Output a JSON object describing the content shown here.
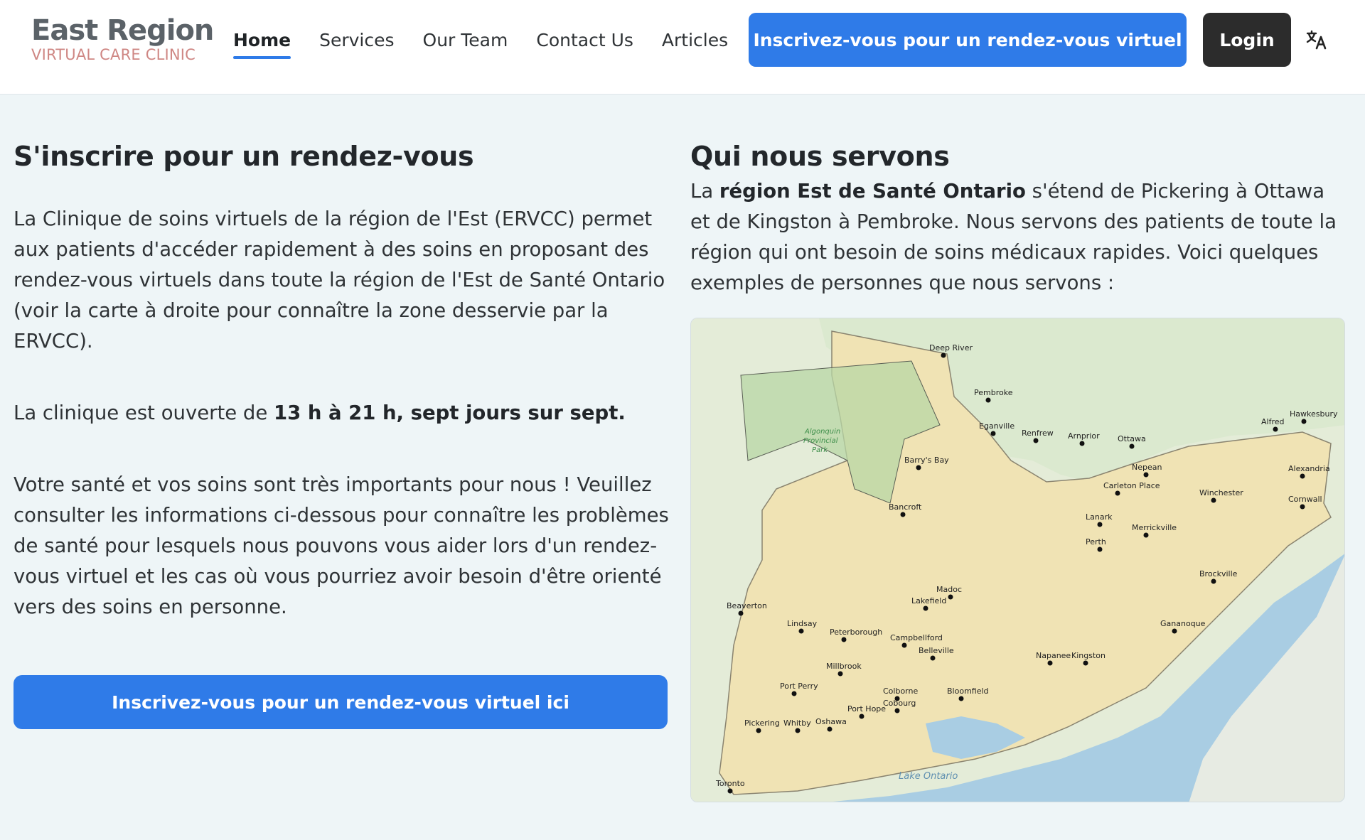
{
  "header": {
    "logo_line1": "East Region",
    "logo_line2": "VIRTUAL CARE CLINIC",
    "nav": [
      {
        "label": "Home",
        "active": true
      },
      {
        "label": "Services"
      },
      {
        "label": "Our Team"
      },
      {
        "label": "Contact Us"
      },
      {
        "label": "Articles"
      }
    ],
    "signup_label": "Inscrivez-vous pour un rendez-vous virtuel",
    "login_label": "Login",
    "translate_icon": "translate-icon"
  },
  "left": {
    "title": "S'inscrire pour un rendez-vous",
    "p1": "La Clinique de soins virtuels de la région de l'Est (ERVCC) permet aux patients d'accéder rapidement à des soins en proposant des rendez-vous virtuels dans toute la région de l'Est de Santé Ontario (voir la carte à droite pour connaître la zone desservie par la ERVCC).",
    "p2_pre": "La clinique est ouverte de ",
    "p2_bold": "13 h à 21 h, sept jours sur sept.",
    "p3": "Votre santé et vos soins sont très importants pour nous ! Veuillez consulter les informations ci-dessous pour connaître les problèmes de santé pour lesquels nous pouvons vous aider lors d'un rendez-vous virtuel et les cas où vous pourriez avoir besoin d'être orienté vers des soins en personne.",
    "button_label": "Inscrivez-vous pour un rendez-vous virtuel ici"
  },
  "right": {
    "title": "Qui nous servons",
    "p_pre": "La ",
    "p_bold": "région Est de Santé Ontario",
    "p_post": " s'étend de Pickering à Ottawa et de Kingston à Pembroke. Nous servons des patients de toute la région qui ont besoin de soins médicaux rapides. Voici quelques exemples de personnes que nous servons :"
  },
  "map": {
    "park_label": [
      "Algonquin",
      "Provincial",
      "Park"
    ],
    "lake_label": "Lake Ontario",
    "cities": [
      "Deep River",
      "Pembroke",
      "Eganville",
      "Renfrew",
      "Arnprior",
      "Ottawa",
      "Hawkesbury",
      "Alfred",
      "Alexandria",
      "Nepean",
      "Barry's Bay",
      "Carleton Place",
      "Winchester",
      "Cornwall",
      "Bancroft",
      "Lanark",
      "Perth",
      "Merrickville",
      "Brockville",
      "Madoc",
      "Lakefield",
      "Beaverton",
      "Lindsay",
      "Peterborough",
      "Campbellford",
      "Gananoque",
      "Napanee",
      "Kingston",
      "Belleville",
      "Millbrook",
      "Port Perry",
      "Colborne",
      "Bloomfield",
      "Port Hope",
      "Cobourg",
      "Pickering",
      "Whitby",
      "Oshawa",
      "Toronto"
    ],
    "colors": {
      "water": "#a9cde3",
      "land": "#e4ecd8",
      "region": "#f0e3b4",
      "park": "#b8d7a6",
      "border": "#5a5f55"
    }
  },
  "colors": {
    "accent": "#2f7be8",
    "dark_button": "#2c2c2c",
    "background": "#eef5f7",
    "logo_red": "#cf8784"
  }
}
